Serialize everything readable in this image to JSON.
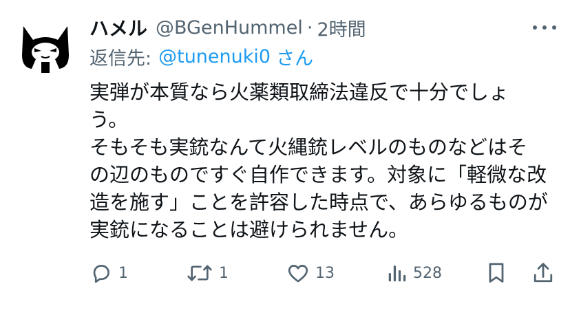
{
  "tweet": {
    "display_name": "ハメル",
    "handle": "@BGenHummel",
    "separator": "·",
    "time": "2時間",
    "replying_prefix": "返信先:",
    "replying_to": "@tunenuki0",
    "replying_suffix": "さん",
    "body_lines": [
      "実弾が本質なら火薬類取締法違反で十分でしょ",
      "う。",
      "そもそも実銃なんて火縄銃レベルのものなどはそ",
      "の辺のものですぐ自作できます。対象に「軽微な改",
      "造を施す」ことを許容した時点で、あらゆるものが",
      "実銃になることは避けられません。"
    ]
  },
  "actions": {
    "reply_count": "1",
    "retweet_count": "1",
    "like_count": "13",
    "views_count": "528"
  },
  "icons": {
    "avatar": "hooded-cat-avatar",
    "more": "more-icon",
    "reply": "reply-icon",
    "retweet": "retweet-icon",
    "like": "heart-icon",
    "views": "views-icon",
    "bookmark": "bookmark-icon",
    "share": "share-icon"
  },
  "colors": {
    "text": "#0f1419",
    "secondary": "#536471",
    "link": "#1d9bf0"
  }
}
